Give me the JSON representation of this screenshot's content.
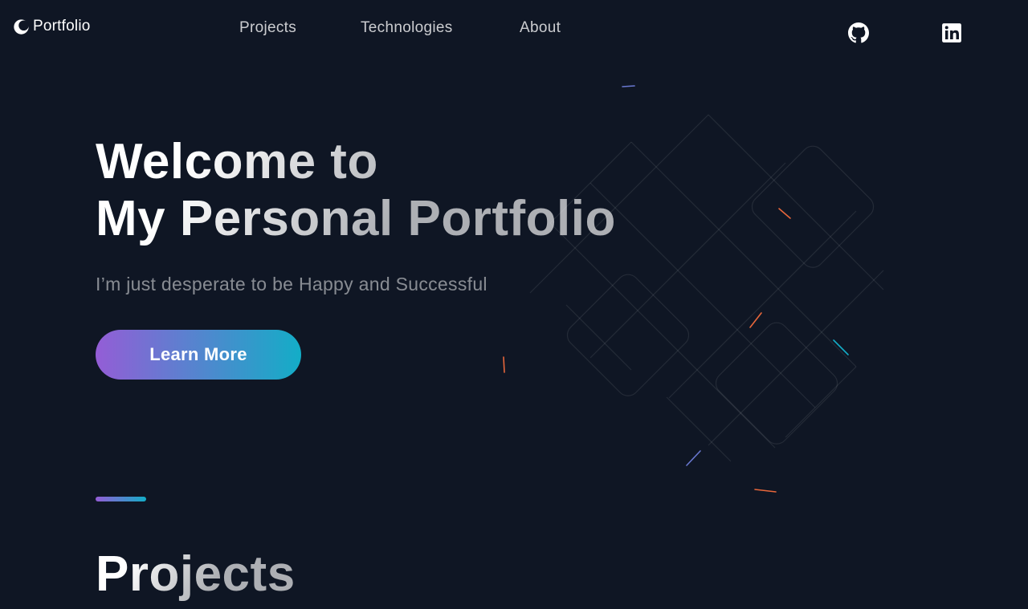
{
  "header": {
    "logo_text": "Portfolio",
    "nav": [
      {
        "label": "Projects"
      },
      {
        "label": "Technologies"
      },
      {
        "label": "About"
      }
    ],
    "social": [
      {
        "icon": "github-icon"
      },
      {
        "icon": "linkedin-icon"
      }
    ]
  },
  "hero": {
    "title_line1": "Welcome to",
    "title_line2": "My Personal Portfolio",
    "subtitle": "I’m just desperate to be Happy and Successful",
    "cta_label": "Learn More"
  },
  "projects_section": {
    "title": "Projects"
  },
  "colors": {
    "background": "#0f1624",
    "gradient_start": "#945DD6",
    "gradient_mid": "#6978D1",
    "gradient_end": "#13ADC7"
  }
}
